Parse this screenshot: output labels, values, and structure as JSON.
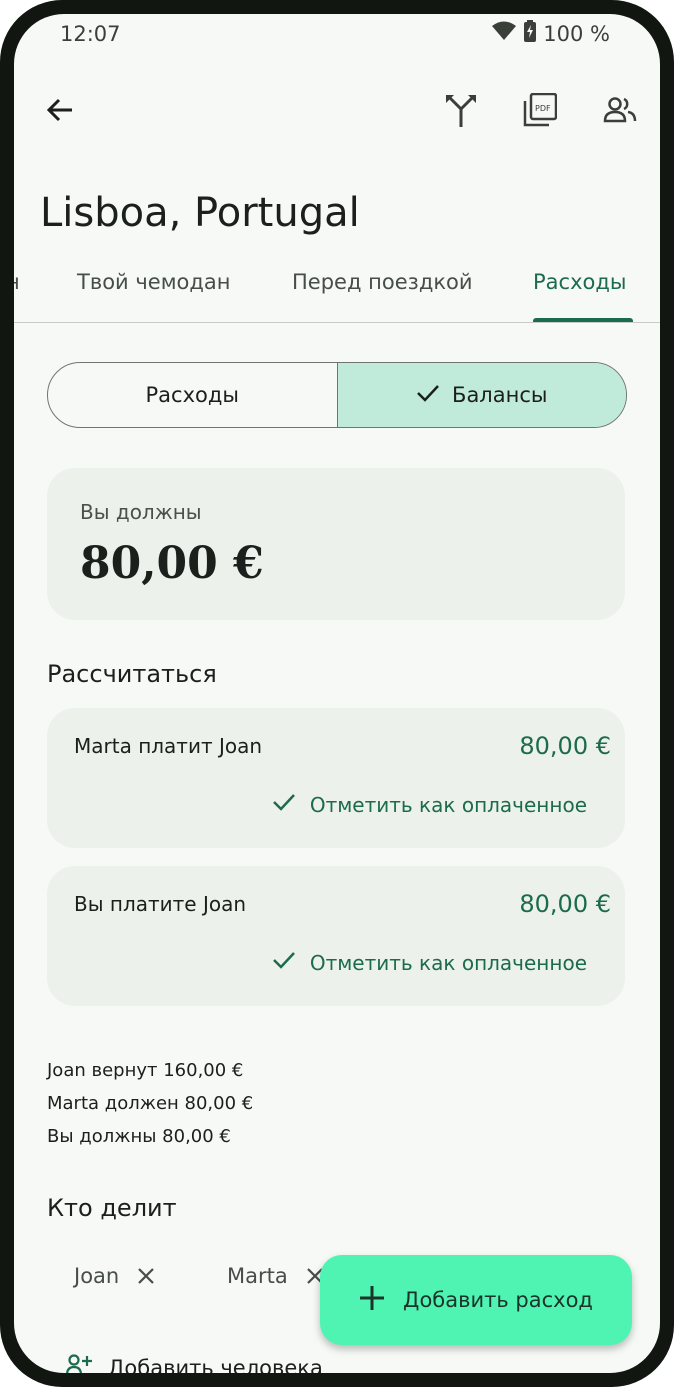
{
  "status_bar": {
    "time": "12:07",
    "battery": "100 %"
  },
  "app_bar": {
    "back_icon": "arrow-left-icon",
    "actions": [
      "merge-icon",
      "pdf-icon",
      "people-icon"
    ]
  },
  "title": "Lisboa, Portugal",
  "tabs": [
    {
      "label": "н"
    },
    {
      "label": "Твой чемодан"
    },
    {
      "label": "Перед поездкой"
    },
    {
      "label": "Расходы",
      "active": true
    }
  ],
  "segmented": {
    "expenses_label": "Расходы",
    "balances_label": "Балансы",
    "selected": "Балансы"
  },
  "balance_card": {
    "label": "Вы должны",
    "amount": "80,00 €"
  },
  "settle": {
    "heading": "Рассчитаться",
    "items": [
      {
        "text": "Marta платит Joan",
        "amount": "80,00 €",
        "action": "Отметить как оплаченное"
      },
      {
        "text": "Вы платите Joan",
        "amount": "80,00 €",
        "action": "Отметить как оплаченное"
      }
    ]
  },
  "summary": [
    "Joan вернут 160,00 €",
    "Marta должен 80,00 €",
    "Вы должны 80,00 €"
  ],
  "sharing": {
    "heading": "Кто делит",
    "chips": [
      "Joan",
      "Marta"
    ],
    "add_person": "Добавить человека"
  },
  "fab": {
    "label": "Добавить расход"
  },
  "colors": {
    "accent": "#1c6b4e",
    "fab": "#4ff4b2",
    "segment_selected": "#c0ead9",
    "card": "#ecf1ec",
    "background": "#f6f9f5"
  }
}
